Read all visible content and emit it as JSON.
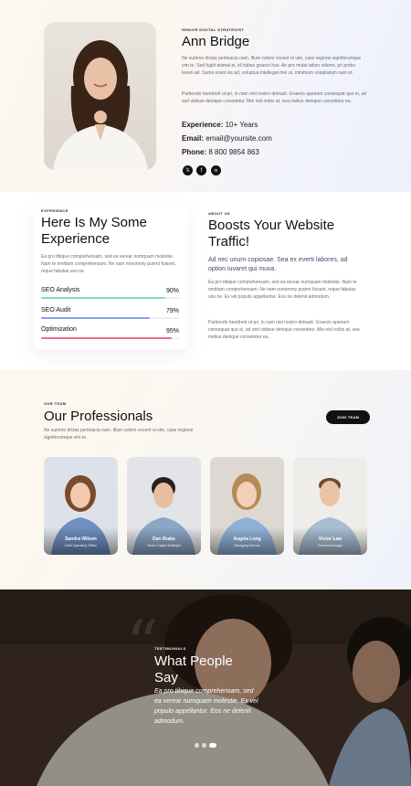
{
  "hero": {
    "eyebrow": "SENIOR DIGITAL STRATEGIST",
    "name": "Ann Bridge",
    "para1": "Ne summo dictas pertinacia nam. Illum cetero vocent ei vim, case regione signiferumque vim te. Sed fugiit animal ei, id habeo graeco has. An pro mutat tation viderer, pri probo lorem ad. Sumo erant ius ad, voluptua intellegat mei ut, minimum voluptatum nam et.",
    "para2": "Partiendo hendrerit ut pri, in nam nisl nostro detraxit. Graecis aperiam consequat quo ei, ad sed vidisse denique consetetur. Mei nisl nobis at, sea melius denique consetetur ea.",
    "experience_label": "Experience:",
    "experience_value": "10+ Years",
    "email_label": "Email:",
    "email_value": "email@yoursite.com",
    "phone_label": "Phone:",
    "phone_value": "8 800 9854 863",
    "social": [
      {
        "icon": "x-twitter-icon",
        "glyph": "𝕏"
      },
      {
        "icon": "facebook-icon",
        "glyph": "f"
      },
      {
        "icon": "linkedin-icon",
        "glyph": "in"
      }
    ]
  },
  "experience": {
    "eyebrow": "EXPERIENCE",
    "title": "Here Is My Some Experience",
    "text": "Ea pro tibique comprehensam, sed ea verear numquam molestie. Nam te omittam comprehensam. Ne nam nonummy putent fuisset, reque fabulas usu ne.",
    "skills": [
      {
        "label": "SEO Analysis",
        "value": "90%",
        "pct": 90,
        "color": "#7fd9cf"
      },
      {
        "label": "SEO Audit",
        "value": "79%",
        "pct": 79,
        "color": "#8aa0f0"
      },
      {
        "label": "Optimization",
        "value": "95%",
        "pct": 95,
        "color": "#f06a8a"
      }
    ]
  },
  "about": {
    "eyebrow": "ABOUT US",
    "title": "Boosts Your Website Traffic!",
    "lead": "Ad nec unum copiosae. Sea ex everti labores, ad option iuvaret qui muva.",
    "para1": "Ea pro tibique comprehensam, sed ea verear numquam molestie. Nam te omittam comprehensam. Ne nam nonummy putent fuisset, reque fabulas usu ne. Ex vel populo appellantur. Eos ne delenit admodum.",
    "para2": "Partiendo hendrerit ut pri, in nam nisl nostro detraxit. Graecis aperiam consequat quo ei, ad sed vidisse denique consetetur. Mei nisl nobis at, sea melius denique consetetur ea."
  },
  "team": {
    "eyebrow": "OUR TEAM",
    "title": "Our Professionals",
    "text": "Ne summo dictas pertinacia nam. Illum cetero vocent ei vim, case regione signiferumque vim te.",
    "join_label": "JOIN TEAM",
    "members": [
      {
        "name": "Sandra Wilson",
        "role": "Chief Operating Officer",
        "bg1": "#d8dde6",
        "bg2": "#6f8fc0"
      },
      {
        "name": "Dan Brake",
        "role": "Senior Digital Strategist",
        "bg1": "#dfe2e6",
        "bg2": "#8ca6c6"
      },
      {
        "name": "Angela Long",
        "role": "Managing Director",
        "bg1": "#d9d6d0",
        "bg2": "#8fb0d6"
      },
      {
        "name": "Victor Law",
        "role": "General Manager",
        "bg1": "#eceae6",
        "bg2": "#a8bcd2"
      }
    ]
  },
  "testimonials": {
    "eyebrow": "TESTIMONIALS",
    "title": "What People Say",
    "quote": "Ea pro tibique comprehensam, sed ea verear numquam molestie. Ex vel populo appellantur. Eos ne delenit admodum.",
    "quote_glyph": "“"
  }
}
